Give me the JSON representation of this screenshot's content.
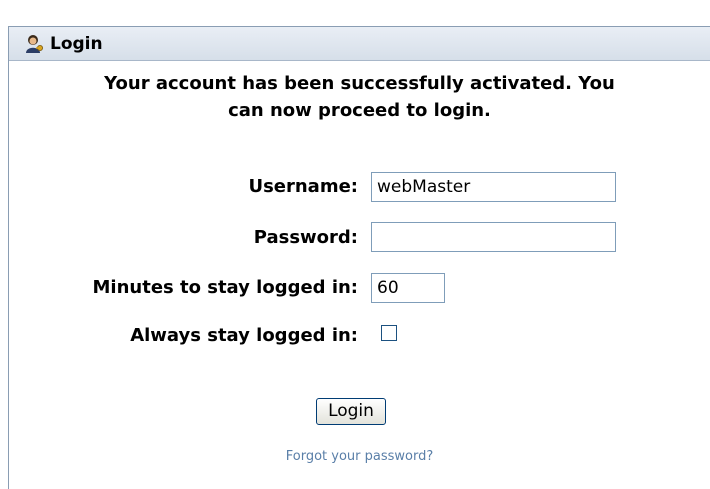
{
  "window": {
    "title": "Login",
    "icon": "user-key-icon"
  },
  "message": {
    "line1": "Your account has been successfully activated. You",
    "line2": "can now proceed to login."
  },
  "form": {
    "username_label": "Username:",
    "username_value": "webMaster",
    "password_label": "Password:",
    "password_value": "",
    "minutes_label": "Minutes to stay logged in:",
    "minutes_value": "60",
    "always_label": "Always stay logged in:",
    "always_checked": false,
    "login_button": "Login",
    "forgot_link": "Forgot your password?"
  },
  "colors": {
    "titlebar": "#dfe6ee",
    "link": "#5a7fa8",
    "input_border": "#7f9db9"
  }
}
